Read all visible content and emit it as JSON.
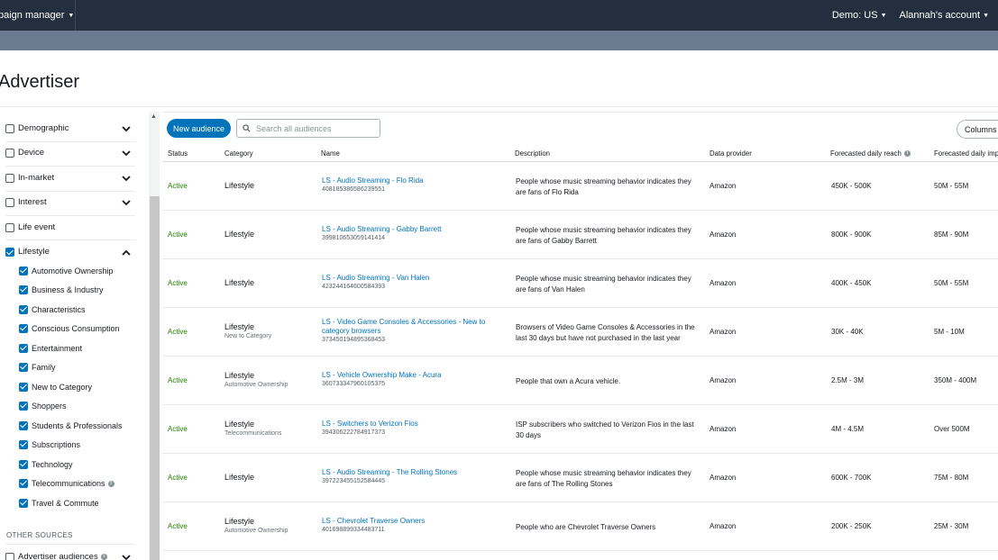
{
  "topbar": {
    "app_name": "paign manager",
    "region": "Demo: US",
    "account": "Alannah's account"
  },
  "page": {
    "title": "Advertiser"
  },
  "sidebar": {
    "groups": [
      {
        "label": "Demographic",
        "checked": false,
        "expanded": false
      },
      {
        "label": "Device",
        "checked": false,
        "expanded": false
      },
      {
        "label": "In-market",
        "checked": false,
        "expanded": false
      },
      {
        "label": "Interest",
        "checked": false,
        "expanded": false
      },
      {
        "label": "Life event",
        "checked": false
      },
      {
        "label": "Lifestyle",
        "checked": true,
        "expanded": true
      }
    ],
    "lifestyle_items": [
      "Automotive Ownership",
      "Business & Industry",
      "Characteristics",
      "Conscious Consumption",
      "Entertainment",
      "Family",
      "New to Category",
      "Shoppers",
      "Students & Professionals",
      "Subscriptions",
      "Technology",
      "Telecommunications",
      "Travel & Commute"
    ],
    "other_sources_heading": "OTHER SOURCES",
    "advertiser_audiences": "Advertiser audiences"
  },
  "toolbar": {
    "new_audience": "New audience",
    "search_placeholder": "Search all audiences",
    "columns": "Columns"
  },
  "table": {
    "headers": {
      "status": "Status",
      "category": "Category",
      "name": "Name",
      "description": "Description",
      "data_provider": "Data provider",
      "reach": "Forecasted daily reach",
      "impressions": "Forecasted daily impre"
    },
    "rows": [
      {
        "status": "Active",
        "category": "Lifestyle",
        "subcategory": "",
        "name": "LS - Audio Streaming - Flo Rida",
        "id": "408185386586239551",
        "description": "People whose music streaming behavior indicates they are fans of Flo Rida",
        "provider": "Amazon",
        "reach": "450K - 500K",
        "impressions": "50M - 55M"
      },
      {
        "status": "Active",
        "category": "Lifestyle",
        "subcategory": "",
        "name": "LS - Audio Streaming - Gabby Barrett",
        "id": "399810653059141414",
        "description": "People whose music streaming behavior indicates they are fans of Gabby Barrett",
        "provider": "Amazon",
        "reach": "800K - 900K",
        "impressions": "85M - 90M"
      },
      {
        "status": "Active",
        "category": "Lifestyle",
        "subcategory": "",
        "name": "LS - Audio Streaming - Van Halen",
        "id": "423244164600584393",
        "description": "People whose music streaming behavior indicates they are fans of Van Halen",
        "provider": "Amazon",
        "reach": "400K - 450K",
        "impressions": "50M - 55M"
      },
      {
        "status": "Active",
        "category": "Lifestyle",
        "subcategory": "New to Category",
        "name": "LS - Video Game Consoles & Accessories - New to category browsers",
        "id": "373450194895368453",
        "description": "Browsers of Video Game Consoles & Accessories in the last 30 days but have not purchased in the last year",
        "provider": "Amazon",
        "reach": "30K - 40K",
        "impressions": "5M - 10M"
      },
      {
        "status": "Active",
        "category": "Lifestyle",
        "subcategory": "Automotive Ownership",
        "name": "LS - Vehicle Ownership Make - Acura",
        "id": "360733347960105375",
        "description": "People that own a Acura vehicle.",
        "provider": "Amazon",
        "reach": "2.5M - 3M",
        "impressions": "350M - 400M"
      },
      {
        "status": "Active",
        "category": "Lifestyle",
        "subcategory": "Telecommunications",
        "name": "LS - Switchers to Verizon Fios",
        "id": "394306222784917373",
        "description": "ISP subscribers who switched to Verizon Fios in the last 30 days",
        "provider": "Amazon",
        "reach": "4M - 4.5M",
        "impressions": "Over 500M"
      },
      {
        "status": "Active",
        "category": "Lifestyle",
        "subcategory": "",
        "name": "LS - Audio Streaming - The Rolling Stones",
        "id": "397223455152584445",
        "description": "People whose music streaming behavior indicates they are fans of The Rolling Stones",
        "provider": "Amazon",
        "reach": "600K - 700K",
        "impressions": "75M - 80M"
      },
      {
        "status": "Active",
        "category": "Lifestyle",
        "subcategory": "Automotive Ownership",
        "name": "LS - Chevrolet Traverse Owners",
        "id": "401698899334483711",
        "description": "People who are Chevrolet Traverse Owners",
        "provider": "Amazon",
        "reach": "200K - 250K",
        "impressions": "25M - 30M"
      }
    ]
  }
}
